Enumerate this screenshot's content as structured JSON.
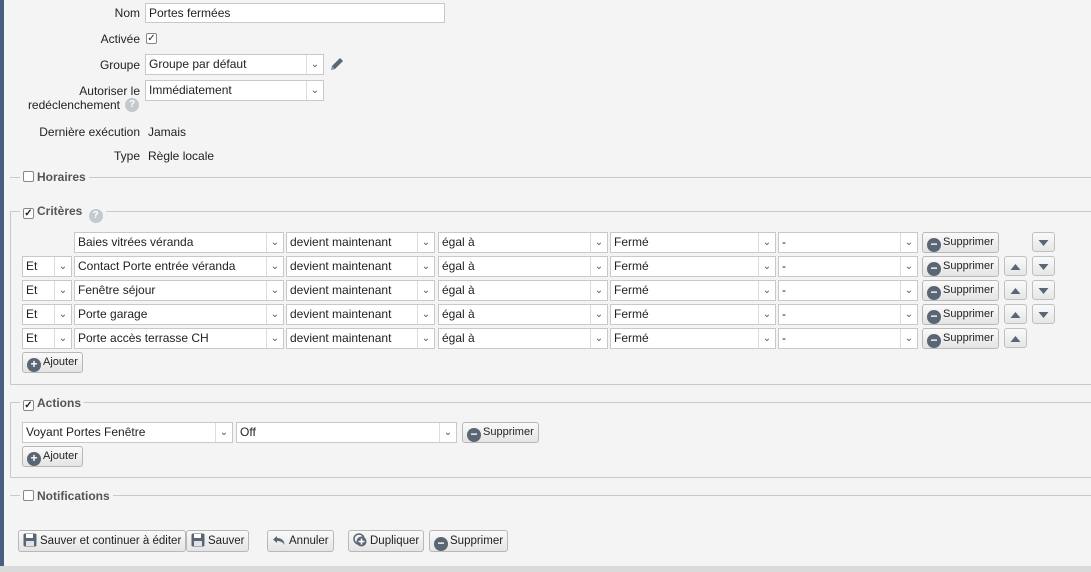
{
  "form": {
    "name_label": "Nom",
    "name_value": "Portes fermées",
    "enabled_label": "Activée",
    "enabled_checked": true,
    "group_label": "Groupe",
    "group_value": "Groupe par défaut",
    "retrigger_label_1": "Autoriser le",
    "retrigger_label_2": "redéclenchement",
    "retrigger_value": "Immédiatement",
    "last_exec_label": "Dernière exécution",
    "last_exec_value": "Jamais",
    "type_label": "Type",
    "type_value": "Règle locale"
  },
  "sections": {
    "schedules": "Horaires",
    "criteria": "Critères",
    "actions": "Actions",
    "notifications": "Notifications"
  },
  "criteria": [
    {
      "conj": "",
      "device": "Baies vitrées véranda",
      "when": "devient maintenant",
      "op": "égal à",
      "value": "Fermé",
      "extra": "-",
      "delete": "Supprimer",
      "up": false,
      "down": true
    },
    {
      "conj": "Et",
      "device": "Contact Porte entrée véranda",
      "when": "devient maintenant",
      "op": "égal à",
      "value": "Fermé",
      "extra": "-",
      "delete": "Supprimer",
      "up": true,
      "down": true
    },
    {
      "conj": "Et",
      "device": "Fenêtre séjour",
      "when": "devient maintenant",
      "op": "égal à",
      "value": "Fermé",
      "extra": "-",
      "delete": "Supprimer",
      "up": true,
      "down": true
    },
    {
      "conj": "Et",
      "device": "Porte garage",
      "when": "devient maintenant",
      "op": "égal à",
      "value": "Fermé",
      "extra": "-",
      "delete": "Supprimer",
      "up": true,
      "down": true
    },
    {
      "conj": "Et",
      "device": "Porte accès terrasse CH",
      "when": "devient maintenant",
      "op": "égal à",
      "value": "Fermé",
      "extra": "-",
      "delete": "Supprimer",
      "up": true,
      "down": false
    }
  ],
  "criteria_add": "Ajouter",
  "action": {
    "device": "Voyant Portes Fenêtre",
    "value": "Off",
    "delete": "Supprimer",
    "add": "Ajouter"
  },
  "footer": {
    "save_continue": "Sauver et continuer à éditer",
    "save": "Sauver",
    "cancel": "Annuler",
    "duplicate": "Dupliquer",
    "delete": "Supprimer"
  },
  "checkboxes": {
    "schedules": false,
    "criteria": true,
    "actions": true,
    "notifications": false
  }
}
